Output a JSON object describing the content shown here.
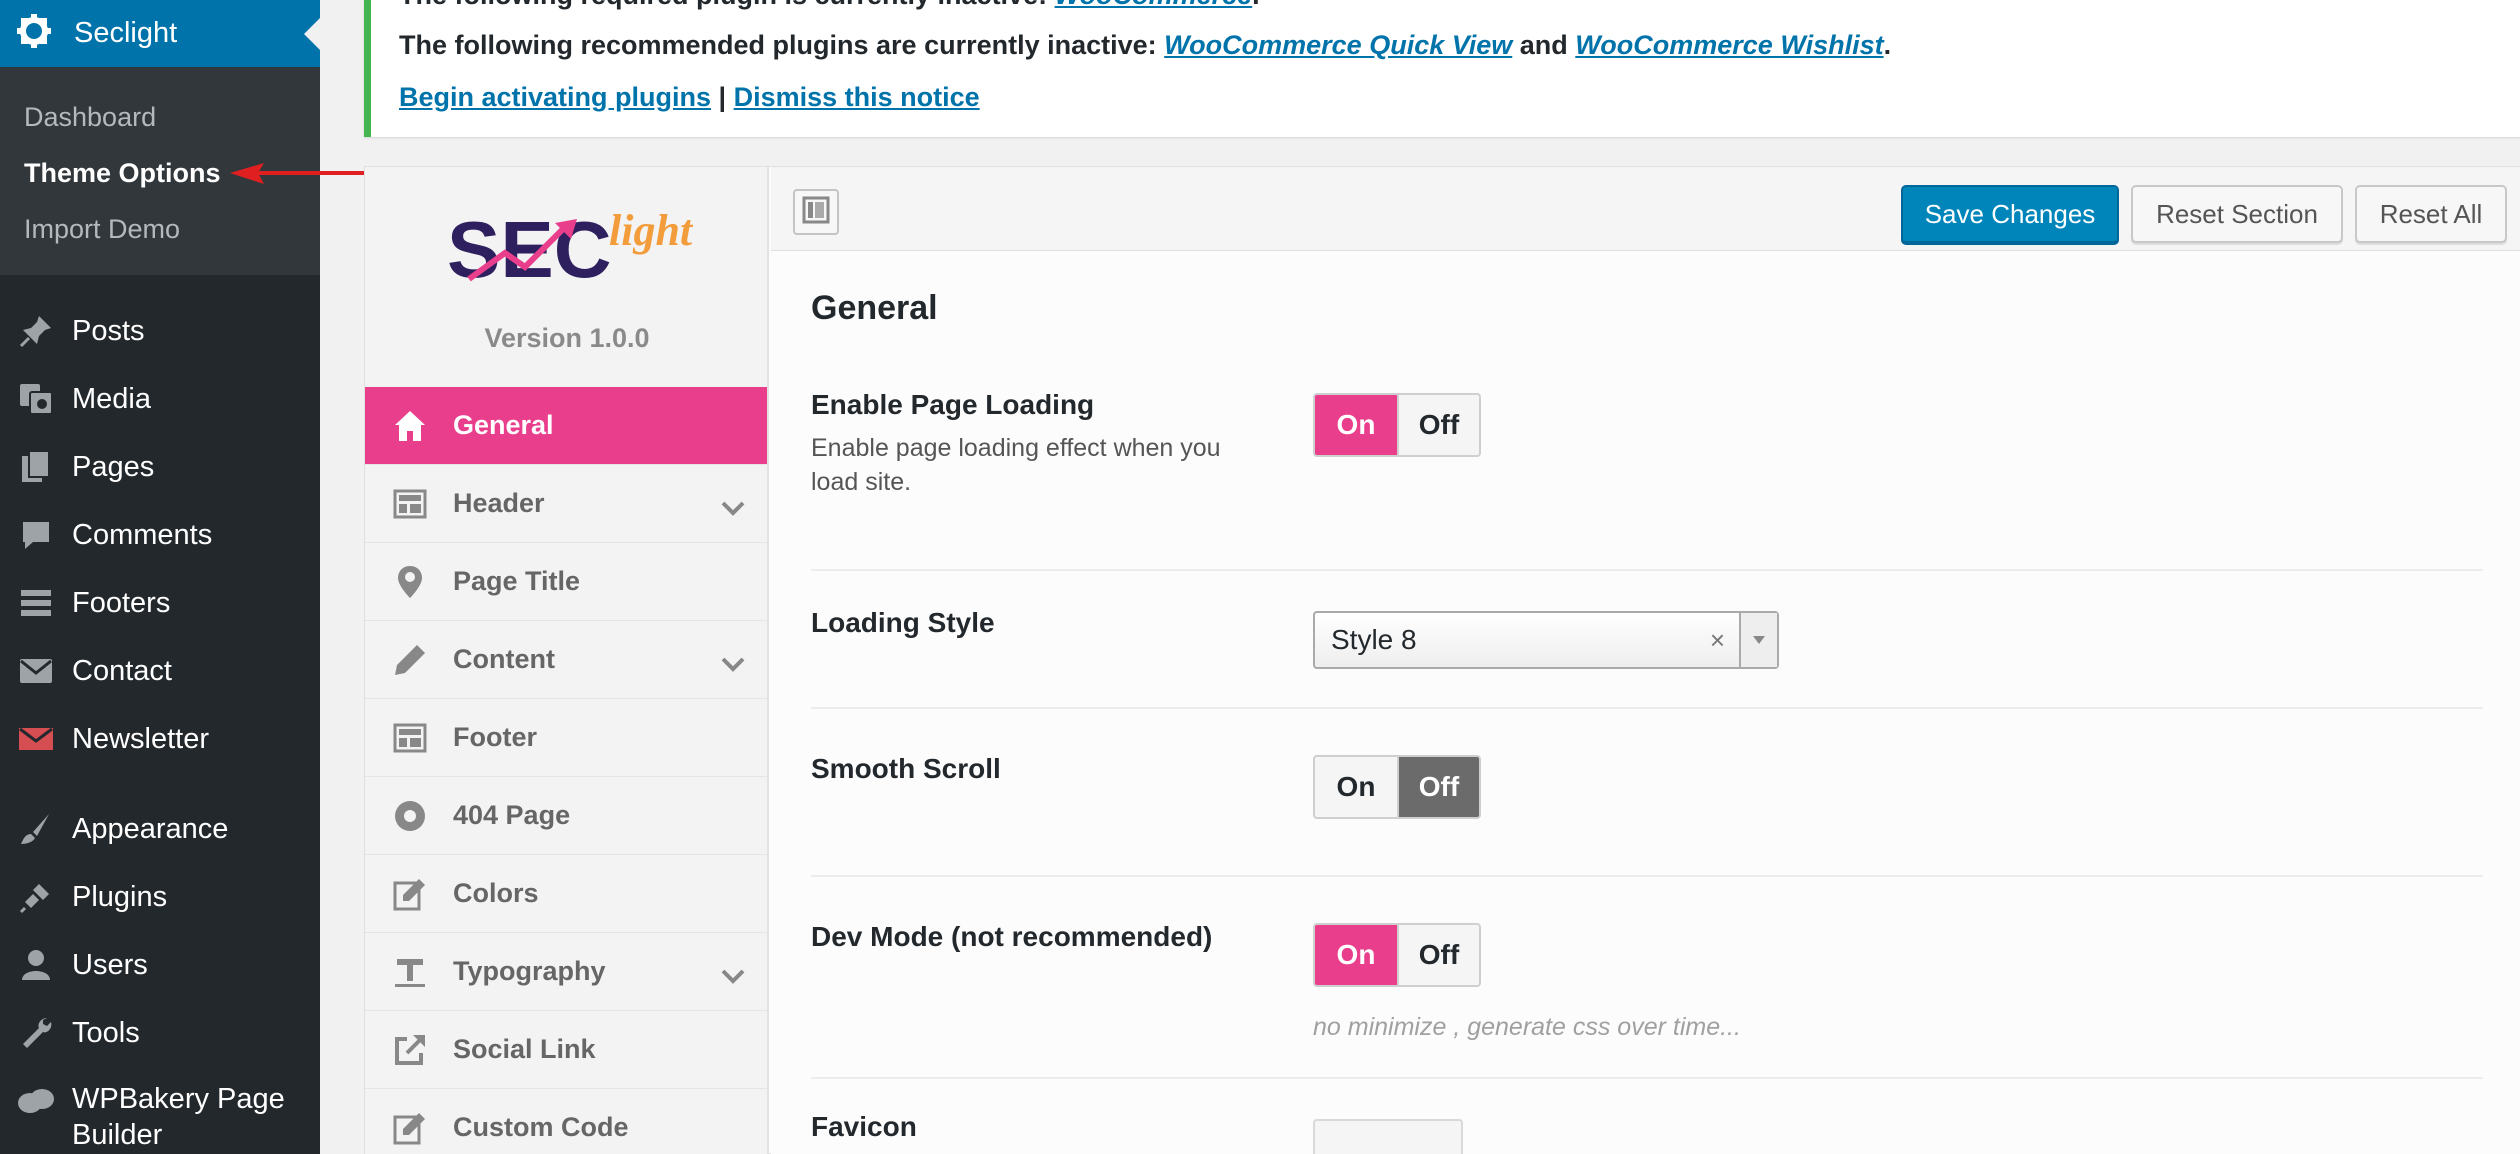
{
  "sidebar": {
    "app_title": "Seclight",
    "submenu": [
      "Dashboard",
      "Theme Options",
      "Import Demo"
    ],
    "items": [
      {
        "label": "Posts",
        "icon": "pin-icon"
      },
      {
        "label": "Media",
        "icon": "media-icon"
      },
      {
        "label": "Pages",
        "icon": "pages-icon"
      },
      {
        "label": "Comments",
        "icon": "comments-icon"
      },
      {
        "label": "Footers",
        "icon": "footers-icon"
      },
      {
        "label": "Contact",
        "icon": "mail-icon"
      },
      {
        "label": "Newsletter",
        "icon": "newsletter-icon"
      }
    ],
    "items2": [
      {
        "label": "Appearance",
        "icon": "paintbrush-icon"
      },
      {
        "label": "Plugins",
        "icon": "plugin-icon"
      },
      {
        "label": "Users",
        "icon": "user-icon"
      },
      {
        "label": "Tools",
        "icon": "wrench-icon"
      },
      {
        "label": "WPBakery Page Builder",
        "icon": "wpbakery-icon"
      }
    ]
  },
  "notice": {
    "line0": "The following required plugin is currently inactive: ",
    "line0_link": "WooCommerce",
    "line0_end": ".",
    "line1": "The following recommended plugins are currently inactive: ",
    "link_quickview": "WooCommerce Quick View",
    "and": " and ",
    "link_wishlist": "WooCommerce Wishlist",
    "line1_end": ".",
    "begin": "Begin activating plugins",
    "sep": " | ",
    "dismiss": "Dismiss this notice"
  },
  "panel": {
    "logo_main": "SEC",
    "logo_accent": "light",
    "version": "Version 1.0.0",
    "nav": [
      {
        "label": "General",
        "icon": "home-icon"
      },
      {
        "label": "Header",
        "icon": "layout-icon"
      },
      {
        "label": "Page Title",
        "icon": "location-icon"
      },
      {
        "label": "Content",
        "icon": "pencil-icon"
      },
      {
        "label": "Footer",
        "icon": "layout-icon"
      },
      {
        "label": "404 Page",
        "icon": "gear-icon"
      },
      {
        "label": "Colors",
        "icon": "edit-icon"
      },
      {
        "label": "Typography",
        "icon": "typography-icon"
      },
      {
        "label": "Social Link",
        "icon": "share-icon"
      },
      {
        "label": "Custom Code",
        "icon": "edit-icon"
      }
    ],
    "buttons": {
      "save": "Save Changes",
      "reset_section": "Reset Section",
      "reset_all": "Reset All"
    },
    "section_title": "General",
    "fields": {
      "page_loading": {
        "title": "Enable Page Loading",
        "desc": "Enable page loading effect when you load site.",
        "on": "On",
        "off": "Off",
        "value": "On"
      },
      "loading_style": {
        "title": "Loading Style",
        "value": "Style 8",
        "clear": "×"
      },
      "smooth_scroll": {
        "title": "Smooth Scroll",
        "on": "On",
        "off": "Off",
        "value": "Off"
      },
      "dev_mode": {
        "title": "Dev Mode (not recommended)",
        "on": "On",
        "off": "Off",
        "value": "On",
        "hint": "no minimize , generate css over time..."
      },
      "favicon": {
        "title": "Favicon"
      }
    }
  },
  "colors": {
    "wp_blue": "#0073aa",
    "accent_pink": "#e83e8c",
    "notice_green": "#46b450",
    "arrow_red": "#e02020"
  }
}
